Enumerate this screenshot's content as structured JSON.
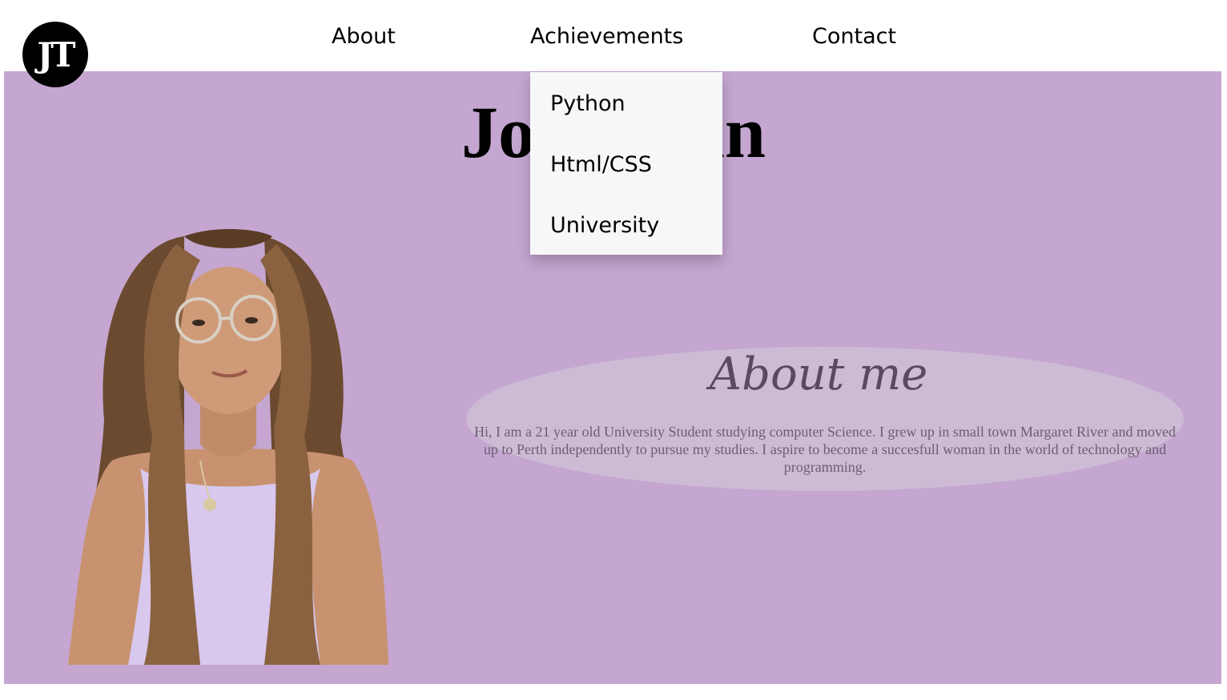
{
  "logo": {
    "text": "JT"
  },
  "nav": {
    "about": "About",
    "achievements": "Achievements",
    "contact": "Contact"
  },
  "dropdown": {
    "items": [
      {
        "label": "Python"
      },
      {
        "label": "Html/CSS"
      },
      {
        "label": "University"
      }
    ]
  },
  "hero": {
    "title": "Jor",
    "title_end": "an",
    "background_color": "#c4a6d0"
  },
  "about": {
    "heading": "About me",
    "text": "Hi, I am a 21 year old University Student studying computer Science. I grew up in small town Margaret River and moved up to Perth independently to pursue my studies. I aspire to become a succesfull woman in the world of technology and programming."
  },
  "colors": {
    "logo_bg": "#000000",
    "dropdown_bg": "#f7f7f7",
    "oval_bg": "#cdbbd5"
  }
}
